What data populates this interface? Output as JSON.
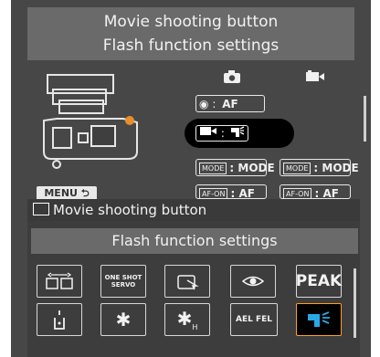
{
  "title": {
    "line1": "Movie shooting button",
    "line2": "Flash function settings"
  },
  "columns": {
    "photo_icon": "camera-icon",
    "movie_icon": "movie-camera-icon"
  },
  "settings_rows": [
    {
      "label": "AF",
      "icon": "eye-af-icon"
    },
    {
      "label": ":",
      "icon": "movie-to-flash"
    },
    {
      "left": "MODE",
      "left_value": ": MODE",
      "right": "MODE",
      "right_value": ": MODE"
    },
    {
      "left": "AF-ON",
      "left_value": ": AF",
      "right": "AF-ON",
      "right_value": ": AF"
    }
  ],
  "menu_button": "MENU",
  "callout": {
    "label": "Movie shooting button"
  },
  "panel": {
    "header": "Flash function settings",
    "tiles": [
      {
        "name": "af-area-tile",
        "text": ""
      },
      {
        "name": "one-shot-servo-tile",
        "text": "ONE SHOT SERVO"
      },
      {
        "name": "af-point-tile",
        "text": ""
      },
      {
        "name": "eye-tile",
        "text": ""
      },
      {
        "name": "peak-tile",
        "text": "PEAK"
      },
      {
        "name": "metering-tile",
        "text": ""
      },
      {
        "name": "ae-lock-tile",
        "text": ""
      },
      {
        "name": "fe-lock-tile",
        "text": ""
      },
      {
        "name": "ael-fel-tile",
        "text": "AEL FEL"
      },
      {
        "name": "flash-function-tile",
        "text": ""
      }
    ]
  },
  "colors": {
    "selection": "#ff9f1a",
    "background": "#474747"
  }
}
